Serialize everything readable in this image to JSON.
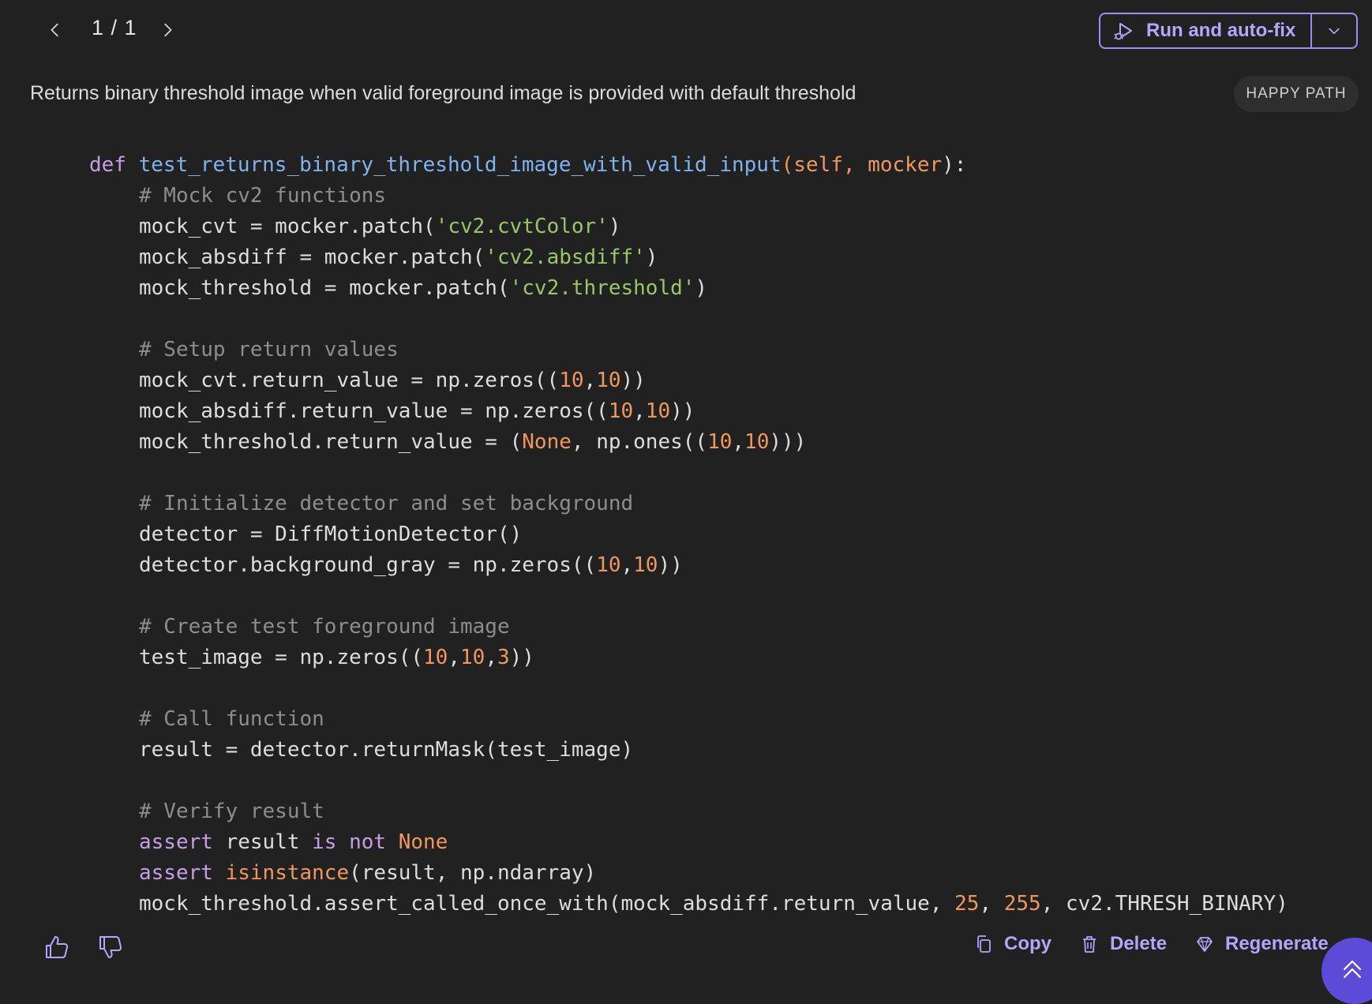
{
  "nav": {
    "pager": "1 / 1"
  },
  "toolbar": {
    "run_label": "Run and auto-fix"
  },
  "test": {
    "description": "Returns binary threshold image when valid foreground image is provided with default threshold",
    "badge": "HAPPY PATH"
  },
  "code": {
    "l01": {
      "kw": "def",
      "fn": "test_returns_binary_threshold_image_with_valid_input",
      "open": "(",
      "p1": "self",
      "sep": ", ",
      "p2": "mocker",
      "close": "):"
    },
    "l02": {
      "cmt": "# Mock cv2 functions"
    },
    "l03": {
      "a": "mock_cvt = mocker.patch(",
      "s": "'cv2.cvtColor'",
      "b": ")"
    },
    "l04": {
      "a": "mock_absdiff = mocker.patch(",
      "s": "'cv2.absdiff'",
      "b": ")"
    },
    "l05": {
      "a": "mock_threshold = mocker.patch(",
      "s": "'cv2.threshold'",
      "b": ")"
    },
    "l06": {
      "cmt": "# Setup return values"
    },
    "l07": {
      "a": "mock_cvt.return_value = np.zeros((",
      "n1": "10",
      "c": ",",
      "n2": "10",
      "b": "))"
    },
    "l08": {
      "a": "mock_absdiff.return_value = np.zeros((",
      "n1": "10",
      "c": ",",
      "n2": "10",
      "b": "))"
    },
    "l09": {
      "a": "mock_threshold.return_value = (",
      "k": "None",
      "m": ", np.ones((",
      "n1": "10",
      "c": ",",
      "n2": "10",
      "b": ")))"
    },
    "l10": {
      "cmt": "# Initialize detector and set background"
    },
    "l11": {
      "a": "detector = DiffMotionDetector()"
    },
    "l12": {
      "a": "detector.background_gray = np.zeros((",
      "n1": "10",
      "c": ",",
      "n2": "10",
      "b": "))"
    },
    "l13": {
      "cmt": "# Create test foreground image"
    },
    "l14": {
      "a": "test_image = np.zeros((",
      "n1": "10",
      "c1": ",",
      "n2": "10",
      "c2": ",",
      "n3": "3",
      "b": "))"
    },
    "l15": {
      "cmt": "# Call function"
    },
    "l16": {
      "a": "result = detector.returnMask(test_image)"
    },
    "l17": {
      "cmt": "# Verify result"
    },
    "l18": {
      "kw1": "assert",
      "a": " result ",
      "kw2": "is not",
      "sp": " ",
      "k": "None"
    },
    "l19": {
      "kw1": "assert",
      "sp": " ",
      "bi": "isinstance",
      "a": "(result, np.ndarray)"
    },
    "l20": {
      "a": "mock_threshold.assert_called_once_with(mock_absdiff.return_value, ",
      "n1": "25",
      "c1": ", ",
      "n2": "255",
      "b": ", cv2.THRESH_BINARY)"
    }
  },
  "footer": {
    "copy_label": "Copy",
    "delete_label": "Delete",
    "regenerate_label": "Regenerate"
  },
  "icons": {
    "prev": "chevron-left-icon",
    "next": "chevron-right-icon",
    "run": "play-bug-icon",
    "dropdown": "chevron-down-icon",
    "thumbs_up": "thumbs-up-icon",
    "thumbs_down": "thumbs-down-icon",
    "copy": "copy-icon",
    "delete": "trash-icon",
    "regenerate": "gem-icon",
    "scroll_top": "double-chevron-up-icon"
  },
  "colors": {
    "background": "#212121",
    "accent": "#b3a6ff",
    "accent_border": "#9d8cf2",
    "fab": "#5b4bd6",
    "keyword": "#c79ee6",
    "function": "#7fb2ee",
    "number": "#f0975f",
    "string": "#98c76a",
    "comment": "#8d8d8d"
  }
}
